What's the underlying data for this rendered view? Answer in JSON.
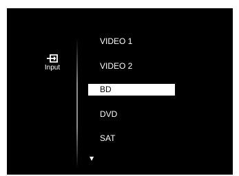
{
  "sidebar": {
    "icon": "input-source-icon",
    "label": "Input"
  },
  "menu": {
    "items": [
      {
        "label": "VIDEO 1",
        "selected": false
      },
      {
        "label": "VIDEO 2",
        "selected": false
      },
      {
        "label": "BD",
        "selected": true
      },
      {
        "label": "DVD",
        "selected": false
      },
      {
        "label": "SAT",
        "selected": false
      }
    ],
    "more_indicator": "▼"
  },
  "colors": {
    "background": "#000000",
    "text": "#ffffff",
    "highlight": "#ffffff",
    "highlight_text": "#000000"
  }
}
